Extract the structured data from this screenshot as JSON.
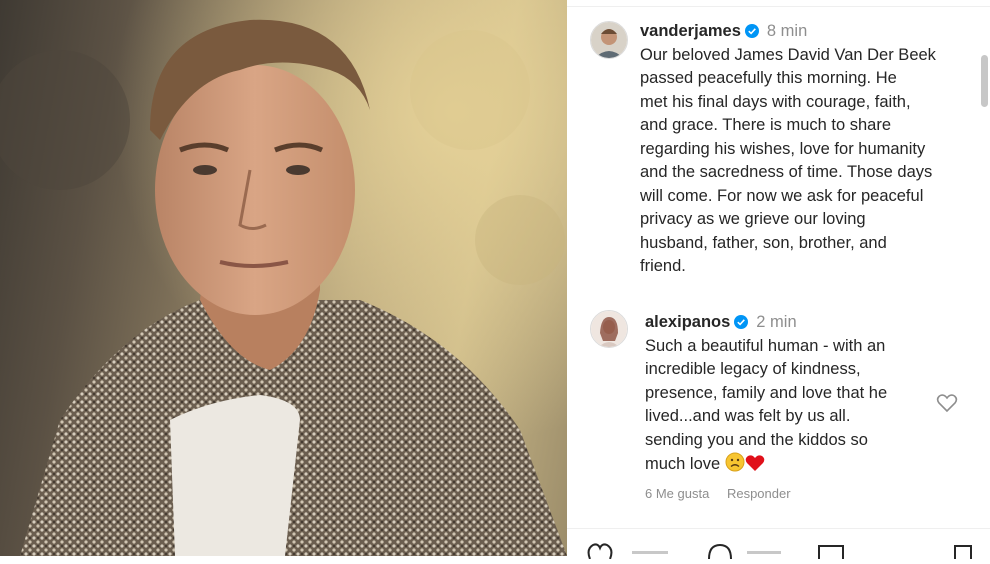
{
  "post": {
    "author": {
      "username": "vanderjames",
      "time": "8 min",
      "caption_lines": [
        "Our beloved James David Van Der Beek",
        "passed peacefully this morning.  He",
        "met his final days with courage, faith,",
        "and grace.  There is much to share",
        "regarding his wishes, love for humanity",
        "and the sacredness of time.  Those days",
        "will come.  For now we ask for peaceful",
        "privacy as we grieve our loving",
        "husband, father, son, brother, and",
        "friend."
      ]
    }
  },
  "comment": {
    "username": "alexipanos",
    "time": "2 min",
    "text_lines": [
      "Such a beautiful human - with an",
      "incredible legacy of kindness,",
      "presence, family and love that he",
      "lived...and was felt by us all.",
      "sending you and the kiddos so",
      "much love"
    ],
    "likes": "6 Me gusta",
    "reply_label": "Responder"
  },
  "icons": {
    "verified": "verified-badge-icon",
    "heart": "heart-icon",
    "sad_emoji": "sad-face-emoji",
    "red_heart": "red-heart-emoji"
  },
  "colors": {
    "verified_blue": "#0095f6",
    "muted_text": "#8e8e8e",
    "red_heart": "#e0101a"
  }
}
